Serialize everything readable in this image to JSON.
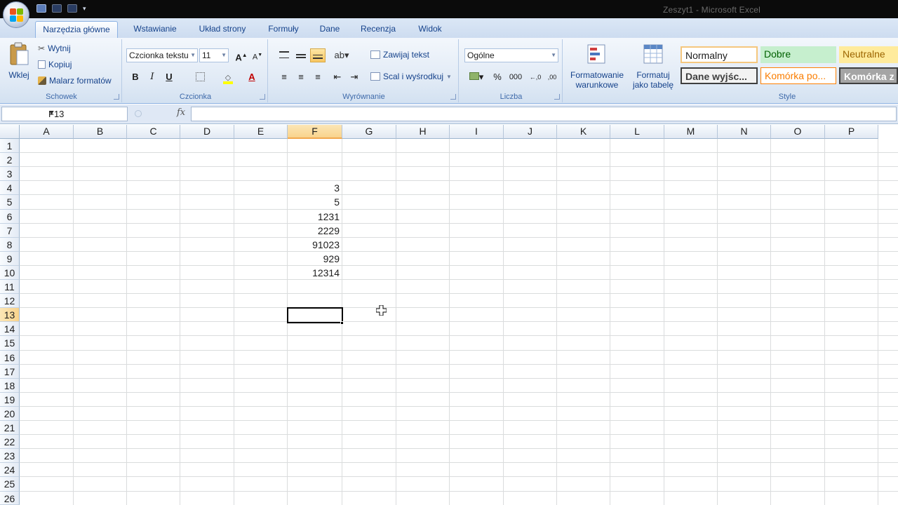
{
  "window": {
    "title": "Zeszyt1 - Microsoft Excel"
  },
  "tabs": [
    "Narzędzia główne",
    "Wstawianie",
    "Układ strony",
    "Formuły",
    "Dane",
    "Recenzja",
    "Widok"
  ],
  "ribbon": {
    "clipboard": {
      "paste": "Wklej",
      "cut": "Wytnij",
      "copy": "Kopiuj",
      "painter": "Malarz formatów",
      "label": "Schowek"
    },
    "font": {
      "name": "Czcionka tekstu",
      "size": "11",
      "bold": "B",
      "italic": "I",
      "underline": "U",
      "label": "Czcionka"
    },
    "alignment": {
      "wrap": "Zawijaj tekst",
      "merge": "Scal i wyśrodkuj",
      "label": "Wyrównanie"
    },
    "number": {
      "format": "Ogólne",
      "percent": "%",
      "thousands": "000",
      "label": "Liczba"
    },
    "styles": {
      "conditional_line1": "Formatowanie",
      "conditional_line2": "warunkowe",
      "table_line1": "Formatuj",
      "table_line2": "jako tabelę",
      "normal": "Normalny",
      "good": "Dobre",
      "neutral": "Neutralne",
      "output": "Dane wyjśc...",
      "linked": "Komórka po...",
      "check": "Komórka z",
      "label": "Style"
    }
  },
  "formula_bar": {
    "name_box": "F13",
    "fx": "fx",
    "value": ""
  },
  "columns": [
    "A",
    "B",
    "C",
    "D",
    "E",
    "F",
    "G",
    "H",
    "I",
    "J",
    "K",
    "L",
    "M",
    "N",
    "O",
    "P"
  ],
  "rows": [
    "1",
    "2",
    "3",
    "4",
    "5",
    "6",
    "7",
    "8",
    "9",
    "10",
    "11",
    "12",
    "13",
    "14",
    "15",
    "16",
    "17",
    "18",
    "19",
    "20",
    "21",
    "22",
    "23",
    "24",
    "25",
    "26"
  ],
  "selected_cell": "F13",
  "cells": [
    {
      "ref": "F4",
      "value": "3"
    },
    {
      "ref": "F5",
      "value": "5"
    },
    {
      "ref": "F6",
      "value": "1231"
    },
    {
      "ref": "F7",
      "value": "2229"
    },
    {
      "ref": "F8",
      "value": "91023"
    },
    {
      "ref": "F9",
      "value": "929"
    },
    {
      "ref": "F10",
      "value": "12314"
    }
  ],
  "colors": {
    "tab_bg": "#dbe7f6",
    "selected_header": "#f9d38c",
    "grid": "#dadcdd"
  }
}
